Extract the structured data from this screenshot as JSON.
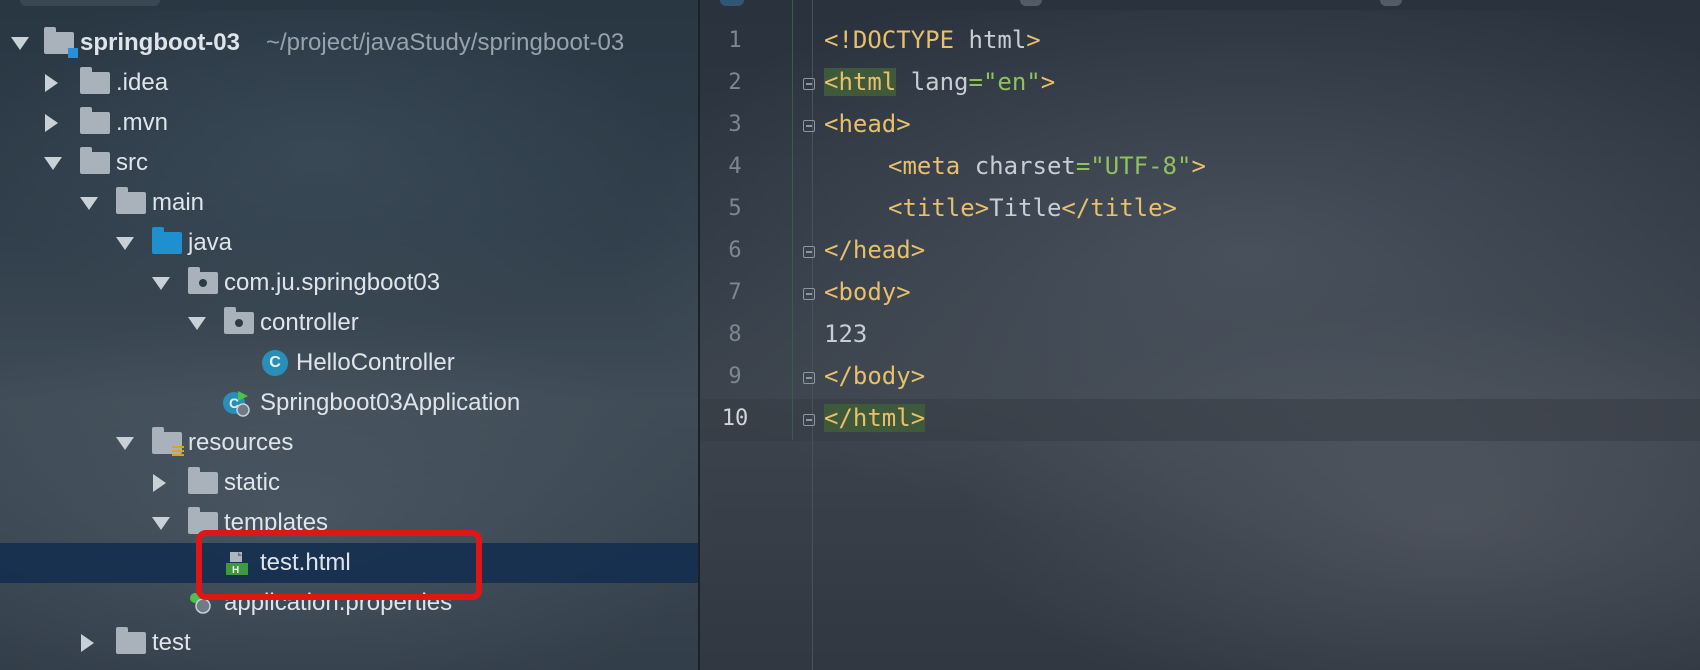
{
  "tree": {
    "root_name": "springboot-03",
    "root_path": "~/project/javaStudy/springboot-03",
    "items": [
      {
        "label": ".idea"
      },
      {
        "label": ".mvn"
      },
      {
        "label": "src"
      },
      {
        "label": "main"
      },
      {
        "label": "java"
      },
      {
        "label": "com.ju.springboot03"
      },
      {
        "label": "controller"
      },
      {
        "label": "HelloController",
        "icon_letter": "C"
      },
      {
        "label": "Springboot03Application"
      },
      {
        "label": "resources"
      },
      {
        "label": "static"
      },
      {
        "label": "templates"
      },
      {
        "label": "test.html",
        "icon_letter": "H"
      },
      {
        "label": "application.properties"
      },
      {
        "label": "test"
      }
    ],
    "selected": "test.html"
  },
  "editor": {
    "line_numbers": [
      "1",
      "2",
      "3",
      "4",
      "5",
      "6",
      "7",
      "8",
      "9",
      "10"
    ],
    "current_line": "10",
    "code": {
      "l1_tag": "<!DOCTYPE",
      "l1_rest": " html",
      "l1_close": ">",
      "l2_open": "<html",
      "l2_attr": " lang",
      "l2_eq": "=",
      "l2_val": "\"en\"",
      "l2_close": ">",
      "l3": "<head>",
      "l4_open": "<meta",
      "l4_attr": " charset",
      "l4_eq": "=",
      "l4_val": "\"UTF-8\"",
      "l4_close": ">",
      "l5_open": "<title>",
      "l5_text": "Title",
      "l5_close": "</title>",
      "l6": "</head>",
      "l7": "<body>",
      "l8": "123",
      "l9": "</body>",
      "l10_open": "</html",
      "l10_close": ">"
    }
  },
  "colors": {
    "selection": "#122e4e",
    "highlight_box": "#e01616",
    "tag": "#e8bf6a",
    "string": "#8fc15f"
  }
}
